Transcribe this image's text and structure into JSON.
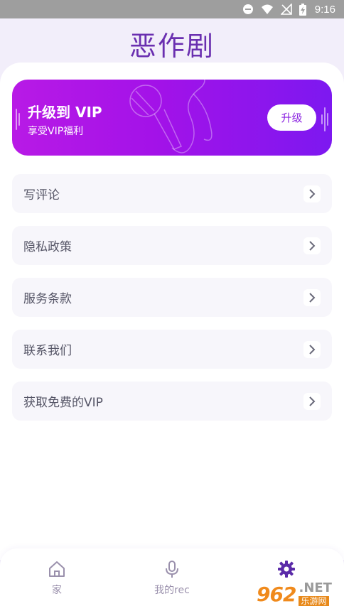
{
  "status_bar": {
    "time": "9:16",
    "icons": [
      "dnd-icon",
      "wifi-icon",
      "no-signal-icon",
      "battery-charging-icon"
    ]
  },
  "app": {
    "title": "恶作剧"
  },
  "vip_card": {
    "title": "升级到 VIP",
    "subtitle": "享受VIP福利",
    "button_label": "升级",
    "gradient": [
      "#b81ae6",
      "#7d18f0"
    ]
  },
  "menu": {
    "items": [
      {
        "label": "写评论"
      },
      {
        "label": "隐私政策"
      },
      {
        "label": "服务条款"
      },
      {
        "label": "联系我们"
      },
      {
        "label": "获取免费的VIP"
      }
    ]
  },
  "bottom_nav": {
    "tabs": [
      {
        "label": "家",
        "icon": "home-icon"
      },
      {
        "label": "我的rec",
        "icon": "microphone-icon"
      },
      {
        "label": "",
        "icon": "settings-icon",
        "active": true
      }
    ]
  },
  "watermark": {
    "number": "962",
    "domain": ".NET",
    "cn_text": "乐游网"
  },
  "colors": {
    "accent": "#6a2fb0",
    "background": "#f2eefa",
    "active_tab": "#5a2aa8"
  }
}
